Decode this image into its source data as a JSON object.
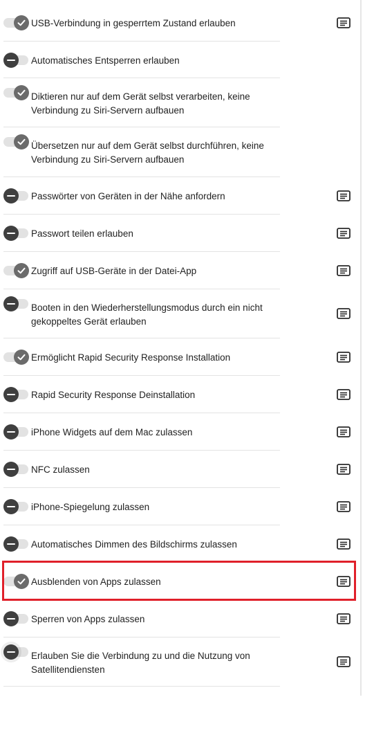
{
  "settings": [
    {
      "label": "USB-Verbindung in gesperrtem Zustand erlauben",
      "enabled": true,
      "info_icon": "info-card-icon"
    },
    {
      "label": "Automatisches Entsperren erlauben",
      "enabled": false,
      "info_icon": null
    },
    {
      "label": "Diktieren nur auf dem Gerät selbst verarbeiten, keine Verbindung zu Siri-Servern aufbauen",
      "enabled": true,
      "info_icon": null
    },
    {
      "label": "Übersetzen nur auf dem Gerät selbst durchführen, keine Verbindung zu Siri-Servern aufbauen",
      "enabled": true,
      "info_icon": null
    },
    {
      "label": "Passwörter von Geräten in der Nähe anfordern",
      "enabled": false,
      "info_icon": "info-card-icon"
    },
    {
      "label": "Passwort teilen erlauben",
      "enabled": false,
      "info_icon": "info-card-icon"
    },
    {
      "label": "Zugriff auf USB-Geräte in der Datei-App",
      "enabled": true,
      "info_icon": "info-card-icon"
    },
    {
      "label": "Booten in den Wiederherstellungsmodus durch ein nicht gekoppeltes Gerät erlauben",
      "enabled": false,
      "info_icon": "info-card-icon"
    },
    {
      "label": "Ermöglicht Rapid Security Response Installation",
      "enabled": true,
      "info_icon": "info-card-icon"
    },
    {
      "label": "Rapid Security Response Deinstallation",
      "enabled": false,
      "info_icon": "info-card-icon"
    },
    {
      "label": "iPhone Widgets auf dem Mac zulassen",
      "enabled": false,
      "info_icon": "info-card-icon"
    },
    {
      "label": "NFC zulassen",
      "enabled": false,
      "info_icon": "info-card-icon"
    },
    {
      "label": "iPhone-Spiegelung zulassen",
      "enabled": false,
      "info_icon": "info-card-icon"
    },
    {
      "label": "Automatisches Dimmen des Bildschirms zulassen",
      "enabled": false,
      "info_icon": "info-card-icon"
    },
    {
      "label": "Ausblenden von Apps zulassen",
      "enabled": true,
      "info_icon": "info-card-icon",
      "highlighted": true
    },
    {
      "label": "Sperren von Apps zulassen",
      "enabled": false,
      "info_icon": "info-card-icon"
    },
    {
      "label": "Erlauben Sie die Verbindung zu und die Nutzung von Satellitendiensten",
      "enabled": false,
      "info_icon": "info-card-icon",
      "focused": true
    }
  ],
  "colors": {
    "highlight_border": "#e0202a",
    "toggle_on_knob": "#6b6b6b",
    "toggle_off_knob": "#3f3f3f",
    "toggle_track": "#e2e2e2",
    "divider": "#e3e3e3"
  }
}
